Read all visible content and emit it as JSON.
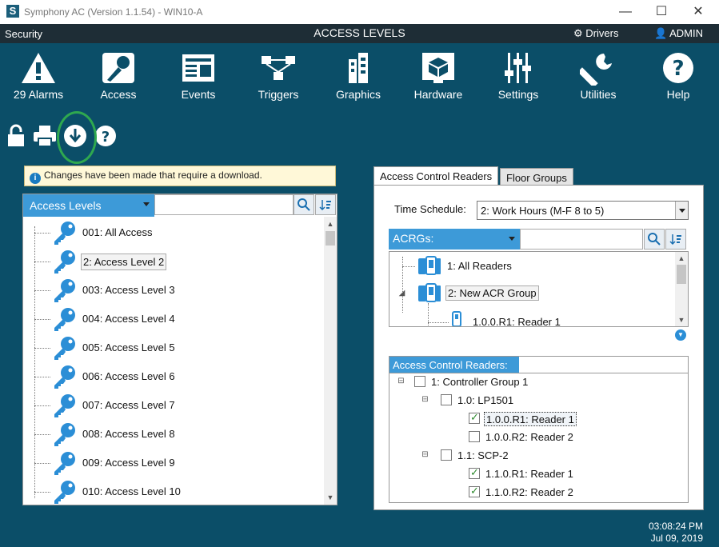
{
  "window": {
    "app_name": "Symphony AC",
    "title": "Symphony AC  (Version 1.1.54) - WIN10-A",
    "logo_letter": "S",
    "controls": {
      "minimize": "—",
      "maximize": "☐",
      "close": "✕"
    }
  },
  "menubar": {
    "left": "Security",
    "center": "ACCESS LEVELS",
    "drivers": "Drivers",
    "admin": "ADMIN"
  },
  "toolbar": [
    {
      "label": "29 Alarms",
      "icon": "alarm-icon"
    },
    {
      "label": "Access",
      "icon": "access-icon"
    },
    {
      "label": "Events",
      "icon": "events-icon"
    },
    {
      "label": "Triggers",
      "icon": "triggers-icon"
    },
    {
      "label": "Graphics",
      "icon": "graphics-icon"
    },
    {
      "label": "Hardware",
      "icon": "hardware-icon"
    },
    {
      "label": "Settings",
      "icon": "settings-icon"
    },
    {
      "label": "Utilities",
      "icon": "utilities-icon"
    },
    {
      "label": "Help",
      "icon": "help-icon"
    }
  ],
  "notice": "Changes have been made that require a download.",
  "left": {
    "dropdown_label": "Access Levels",
    "search_value": "",
    "items": [
      "001: All Access",
      "2: Access Level 2",
      "003: Access Level 3",
      "004: Access Level 4",
      "005: Access Level 5",
      "006: Access Level 6",
      "007: Access Level 7",
      "008: Access Level 8",
      "009: Access Level 9",
      "010: Access Level 10"
    ],
    "selected_index": 1
  },
  "right": {
    "tabs": [
      "Access Control Readers",
      "Floor Groups"
    ],
    "time_schedule_label": "Time Schedule:",
    "time_schedule_value": "2:  Work Hours (M-F 8 to 5)",
    "acrgs_label": "ACRGs:",
    "acrgs_search": "",
    "acrg_items": [
      "1: All Readers",
      "2: New ACR Group",
      "1.0.0.R1: Reader 1"
    ],
    "acr_label": "Access Control Readers:",
    "tree": [
      {
        "label": "1:  Controller Group 1",
        "checked": false
      },
      {
        "label": "1.0:  LP1501",
        "checked": false
      },
      {
        "label": "1.0.0.R1: Reader 1",
        "checked": true
      },
      {
        "label": "1.0.0.R2: Reader 2",
        "checked": false
      },
      {
        "label": "1.1:  SCP-2",
        "checked": false
      },
      {
        "label": "1.1.0.R1: Reader 1",
        "checked": true
      },
      {
        "label": "1.1.0.R2: Reader 2",
        "checked": true
      }
    ]
  },
  "clock": {
    "time": "03:08:24 PM",
    "date": "Jul 09, 2019"
  },
  "colors": {
    "accent": "#3d9ad8",
    "background": "#0b4e68",
    "menubar": "#1e2d36",
    "check": "#2d8a2d",
    "highlight_ring": "#2fa84f"
  }
}
